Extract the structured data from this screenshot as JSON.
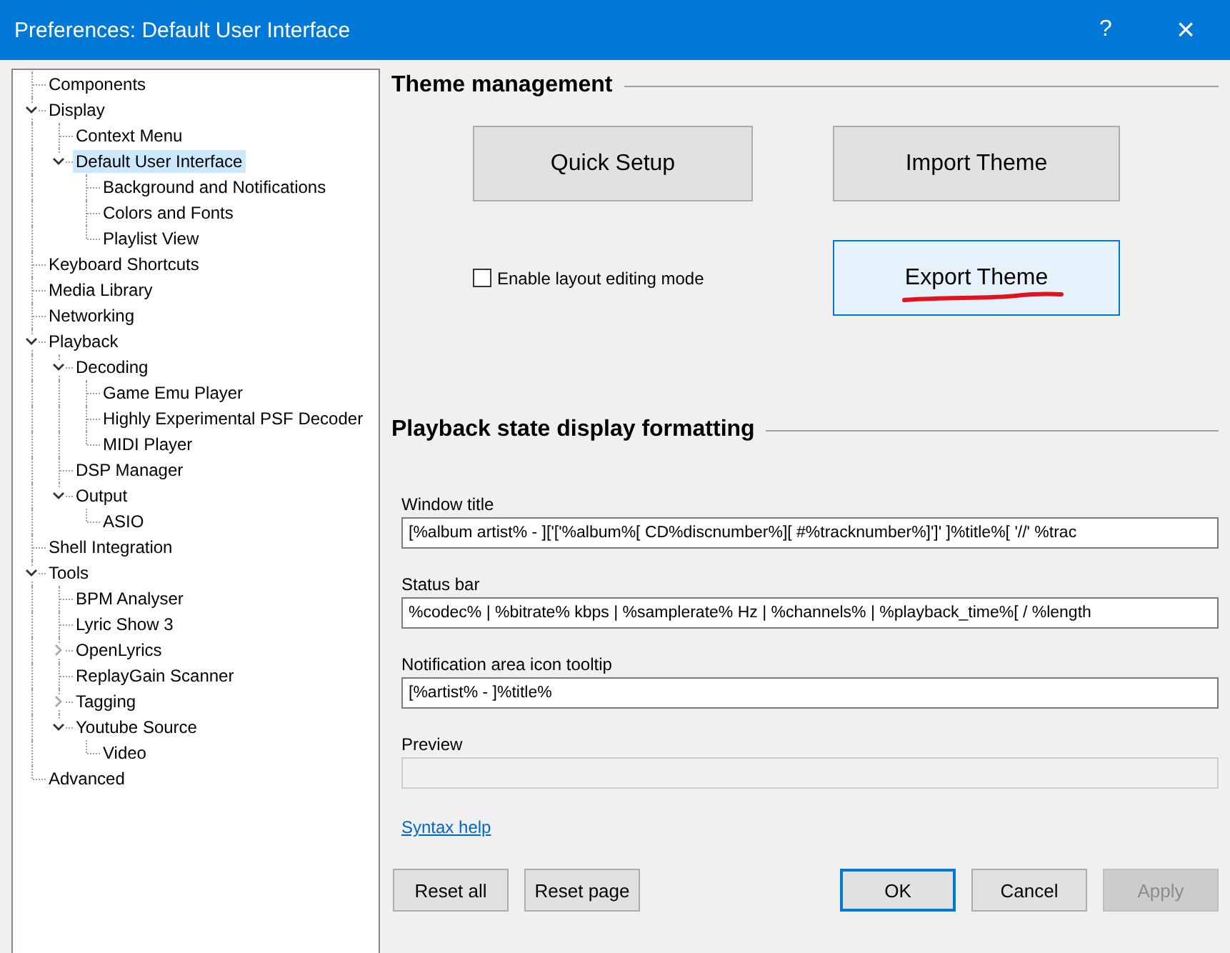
{
  "window": {
    "title": "Preferences: Default User Interface",
    "help_button": "?",
    "close_button": "×"
  },
  "tree": [
    {
      "label": "Components",
      "selected": false
    },
    {
      "label": "Display",
      "selected": false,
      "expanded": true,
      "children": [
        {
          "label": "Context Menu",
          "selected": false
        },
        {
          "label": "Default User Interface",
          "selected": true,
          "expanded": true,
          "children": [
            {
              "label": "Background and Notifications",
              "selected": false
            },
            {
              "label": "Colors and Fonts",
              "selected": false
            },
            {
              "label": "Playlist View",
              "selected": false
            }
          ]
        }
      ]
    },
    {
      "label": "Keyboard Shortcuts",
      "selected": false
    },
    {
      "label": "Media Library",
      "selected": false
    },
    {
      "label": "Networking",
      "selected": false
    },
    {
      "label": "Playback",
      "selected": false,
      "expanded": true,
      "children": [
        {
          "label": "Decoding",
          "selected": false,
          "expanded": true,
          "children": [
            {
              "label": "Game Emu Player",
              "selected": false
            },
            {
              "label": "Highly Experimental PSF Decoder",
              "selected": false
            },
            {
              "label": "MIDI Player",
              "selected": false
            }
          ]
        },
        {
          "label": "DSP Manager",
          "selected": false
        },
        {
          "label": "Output",
          "selected": false,
          "expanded": true,
          "children": [
            {
              "label": "ASIO",
              "selected": false
            }
          ]
        }
      ]
    },
    {
      "label": "Shell Integration",
      "selected": false
    },
    {
      "label": "Tools",
      "selected": false,
      "expanded": true,
      "children": [
        {
          "label": "BPM Analyser",
          "selected": false
        },
        {
          "label": "Lyric Show 3",
          "selected": false
        },
        {
          "label": "OpenLyrics",
          "selected": false,
          "expanded": false
        },
        {
          "label": "ReplayGain Scanner",
          "selected": false
        },
        {
          "label": "Tagging",
          "selected": false,
          "expanded": false
        },
        {
          "label": "Youtube Source",
          "selected": false,
          "expanded": true,
          "children": [
            {
              "label": "Video",
              "selected": false
            }
          ]
        }
      ]
    },
    {
      "label": "Advanced",
      "selected": false
    }
  ],
  "theme_management": {
    "heading": "Theme management",
    "quick_setup": "Quick Setup",
    "import_theme": "Import Theme",
    "export_theme": "Export Theme",
    "layout_editing": {
      "label": "Enable layout editing mode",
      "checked": false
    }
  },
  "formatting": {
    "heading": "Playback state display formatting",
    "fields": [
      {
        "label": "Window title",
        "value": "[%album artist% - ]['['%album%[ CD%discnumber%][ #%tracknumber%]']' ]%title%[ '//' %trac",
        "disabled": false
      },
      {
        "label": "Status bar",
        "value": "%codec% | %bitrate% kbps | %samplerate% Hz | %channels% | %playback_time%[ / %length",
        "disabled": false
      },
      {
        "label": "Notification area icon tooltip",
        "value": "[%artist% - ]%title%",
        "disabled": false
      },
      {
        "label": "Preview",
        "disabled": true
      }
    ],
    "syntax_help": "Syntax help"
  },
  "buttons": [
    {
      "label": "Reset all",
      "kind": "left",
      "disabled": false,
      "default": false
    },
    {
      "label": "Reset page",
      "kind": "left",
      "disabled": false,
      "default": false
    },
    {
      "label": "OK",
      "kind": "right",
      "disabled": false,
      "default": true
    },
    {
      "label": "Cancel",
      "kind": "right",
      "disabled": false,
      "default": false
    },
    {
      "label": "Apply",
      "kind": "right",
      "disabled": true,
      "default": false
    }
  ]
}
